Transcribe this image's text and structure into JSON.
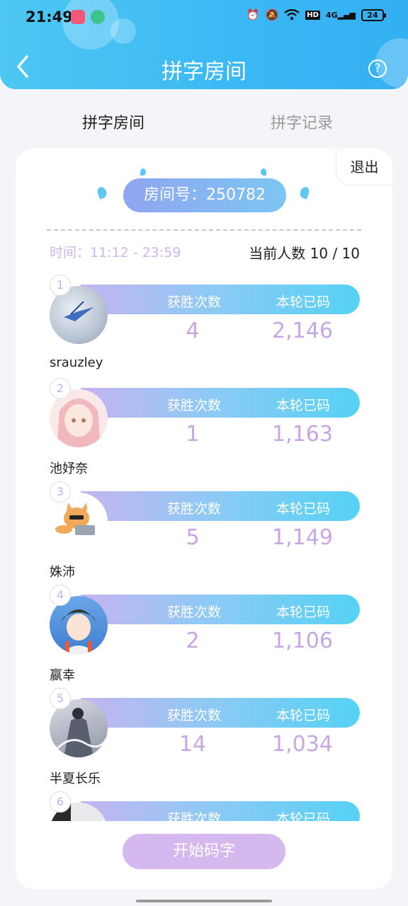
{
  "status_bar": {
    "time": "21:49",
    "network": "4G",
    "battery": "24",
    "hd_label": "HD"
  },
  "header": {
    "title": "拼字房间",
    "help": "?"
  },
  "tabs": [
    {
      "label": "拼字房间",
      "active": true
    },
    {
      "label": "拼字记录",
      "active": false
    }
  ],
  "room": {
    "exit_label": "退出",
    "room_number_label": "房间号：250782",
    "time_label": "时间：11:12 - 23:59",
    "count_label": "当前人数 10 / 10"
  },
  "columns": {
    "wins": "获胜次数",
    "chars": "本轮已码"
  },
  "players": [
    {
      "rank": "1",
      "name": "srauzley",
      "wins": "4",
      "chars": "2,146",
      "avatar": "bird-avatar"
    },
    {
      "rank": "2",
      "name": "池妤奈",
      "wins": "1",
      "chars": "1,163",
      "avatar": "anime-girl-avatar"
    },
    {
      "rank": "3",
      "name": "姝沛",
      "wins": "5",
      "chars": "1,149",
      "avatar": "cat-laptop-avatar"
    },
    {
      "rank": "4",
      "name": "嬴幸",
      "wins": "2",
      "chars": "1,106",
      "avatar": "anime-boy-avatar"
    },
    {
      "rank": "5",
      "name": "半夏长乐",
      "wins": "14",
      "chars": "1,034",
      "avatar": "ink-painting-avatar"
    },
    {
      "rank": "6",
      "name": "",
      "wins": "",
      "chars": "",
      "avatar": "partial-avatar"
    }
  ],
  "start_button": "开始码字",
  "colors": {
    "header": "#3ab8f5",
    "accent_purple": "#c8a6e6",
    "start_button": "#d5b8ee"
  }
}
